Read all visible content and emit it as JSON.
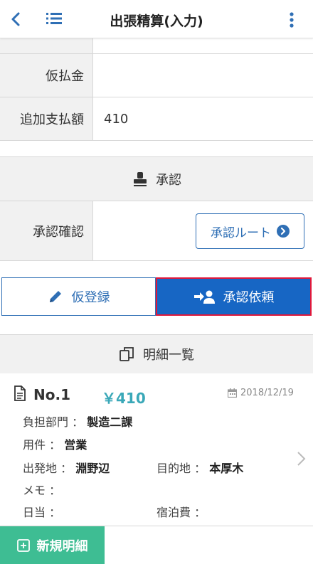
{
  "header": {
    "title": "出張精算(入力)",
    "back_icon": "chevron-left-icon",
    "list_icon": "list-icon",
    "more_icon": "more-vertical-icon"
  },
  "form": {
    "rows": [
      {
        "label": "",
        "value": ""
      },
      {
        "label": "仮払金",
        "value": ""
      },
      {
        "label": "追加支払額",
        "value": "410"
      }
    ]
  },
  "approval": {
    "section_title": "承認",
    "section_icon": "stamp-icon",
    "confirm_label": "承認確認",
    "route_button": "承認ルート",
    "route_icon": "arrow-circle-right-icon"
  },
  "actions": {
    "temp_save": "仮登録",
    "temp_icon": "pencil-icon",
    "request_approval": "承認依頼",
    "request_icon": "user-arrow-icon"
  },
  "details": {
    "section_title": "明細一覧",
    "section_icon": "copy-icon",
    "items": [
      {
        "no": "No.1",
        "amount": "￥410",
        "date": "2018/12/19",
        "department_label": "負担部門 ：",
        "department": "製造二課",
        "purpose_label": "用件 ：",
        "purpose": "営業",
        "from_label": "出発地 ：",
        "from": "淵野辺",
        "to_label": "目的地 ：",
        "to": "本厚木",
        "memo_label": "メモ ：",
        "memo": "",
        "daily_label": "日当 ：",
        "daily": "",
        "lodging_label": "宿泊費 ：",
        "lodging": ""
      }
    ]
  },
  "new_detail_button": "新規明細",
  "colors": {
    "primary": "#1766c4",
    "accent_teal": "#3aa8b8",
    "green": "#3ebd93",
    "highlight_border": "#e0173a"
  }
}
